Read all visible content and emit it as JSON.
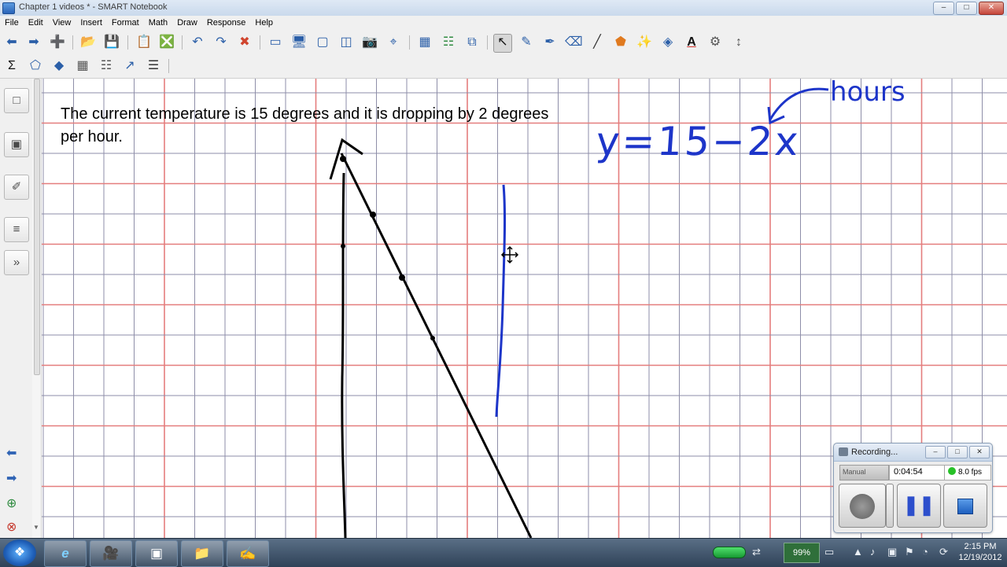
{
  "window": {
    "title": "Chapter 1 videos * - SMART Notebook",
    "controls": {
      "minimize": "–",
      "maximize": "□",
      "close": "✕"
    }
  },
  "menu": [
    "File",
    "Edit",
    "View",
    "Insert",
    "Format",
    "Math",
    "Draw",
    "Response",
    "Help"
  ],
  "toolbar_row1": [
    {
      "icon": "back-arrow-icon",
      "glyph": "⬅"
    },
    {
      "icon": "forward-arrow-icon",
      "glyph": "➡"
    },
    {
      "icon": "add-page-icon",
      "glyph": "➕"
    },
    {
      "icon": "open-folder-icon",
      "glyph": "📂"
    },
    {
      "icon": "save-icon",
      "glyph": "💾"
    },
    {
      "icon": "paste-icon",
      "glyph": "📋"
    },
    {
      "icon": "delete-page-icon",
      "glyph": "❎"
    },
    {
      "icon": "undo-icon",
      "glyph": "↶"
    },
    {
      "icon": "redo-icon",
      "glyph": "↷"
    },
    {
      "icon": "delete-icon",
      "glyph": "✖"
    },
    {
      "icon": "screen-shade-icon",
      "glyph": "▭"
    },
    {
      "icon": "full-screen-icon",
      "glyph": "🖥"
    },
    {
      "icon": "transparent-background-icon",
      "glyph": "▢"
    },
    {
      "icon": "dual-page-icon",
      "glyph": "◫"
    },
    {
      "icon": "screen-capture-icon",
      "glyph": "📷"
    },
    {
      "icon": "document-camera-icon",
      "glyph": "⌖"
    },
    {
      "icon": "insert-table-icon",
      "glyph": "▦"
    },
    {
      "icon": "properties-icon",
      "glyph": "☷"
    },
    {
      "icon": "add-ons-icon",
      "glyph": "⧉"
    },
    {
      "icon": "select-pointer-icon",
      "glyph": "↖"
    },
    {
      "icon": "pen-icon",
      "glyph": "✎"
    },
    {
      "icon": "creative-pen-icon",
      "glyph": "✒"
    },
    {
      "icon": "eraser-icon",
      "glyph": "⌫"
    },
    {
      "icon": "line-icon",
      "glyph": "╱"
    },
    {
      "icon": "shapes-icon",
      "glyph": "⬟"
    },
    {
      "icon": "magic-pen-icon",
      "glyph": "✨"
    },
    {
      "icon": "fill-icon",
      "glyph": "◈"
    },
    {
      "icon": "text-icon",
      "glyph": "A"
    },
    {
      "icon": "properties-gear-icon",
      "glyph": "⚙"
    },
    {
      "icon": "move-toolbar-icon",
      "glyph": "↕"
    }
  ],
  "toolbar_row2": [
    {
      "icon": "sigma-math-icon",
      "glyph": "Σ"
    },
    {
      "icon": "measurement-icon",
      "glyph": "⬠"
    },
    {
      "icon": "geometry-icon",
      "glyph": "◆"
    },
    {
      "icon": "grid-icon",
      "glyph": "▦"
    },
    {
      "icon": "table-icon",
      "glyph": "☷"
    },
    {
      "icon": "graph-icon",
      "glyph": "↗"
    },
    {
      "icon": "response-icon",
      "glyph": "☰"
    }
  ],
  "side_tabs": [
    {
      "icon": "page-sorter-icon",
      "glyph": "□"
    },
    {
      "icon": "gallery-icon",
      "glyph": "▣"
    },
    {
      "icon": "attachments-icon",
      "glyph": "✐"
    },
    {
      "icon": "properties-tab-icon",
      "glyph": "≡"
    },
    {
      "icon": "add-ons-tab-icon",
      "glyph": "»"
    }
  ],
  "side_nav": [
    {
      "icon": "previous-page-icon",
      "glyph": "⬅"
    },
    {
      "icon": "next-page-icon",
      "glyph": "➡"
    },
    {
      "icon": "add-page-side-icon",
      "glyph": "⊕"
    },
    {
      "icon": "delete-page-side-icon",
      "glyph": "⊗"
    }
  ],
  "canvas": {
    "prompt": "The current temperature is 15 degrees and it is dropping by 2 degrees per hour.",
    "equation": "y=15−2x",
    "hours_label": "hours",
    "colors": {
      "ink_black": "#000000",
      "ink_blue": "#1d35c9",
      "grid_minor": "#8e8ea8",
      "grid_major": "#e47d7d"
    }
  },
  "recorder": {
    "title": "Recording...",
    "mode": "Manual",
    "elapsed": "0:04:54",
    "fps": "8.0 fps",
    "controls": {
      "minimize": "–",
      "maximize": "□",
      "close": "✕"
    }
  },
  "taskbar": {
    "start_glyph": "❖",
    "apps": [
      {
        "icon": "internet-explorer-icon",
        "glyph": "e"
      },
      {
        "icon": "video-camera-app-icon",
        "glyph": "🎥"
      },
      {
        "icon": "recorder-app-icon",
        "glyph": "▣"
      },
      {
        "icon": "folder-app-icon",
        "glyph": "📁"
      },
      {
        "icon": "smart-notebook-app-icon",
        "glyph": "✍"
      }
    ],
    "battery_percent": "99%",
    "time": "2:15 PM",
    "date": "12/19/2012"
  }
}
